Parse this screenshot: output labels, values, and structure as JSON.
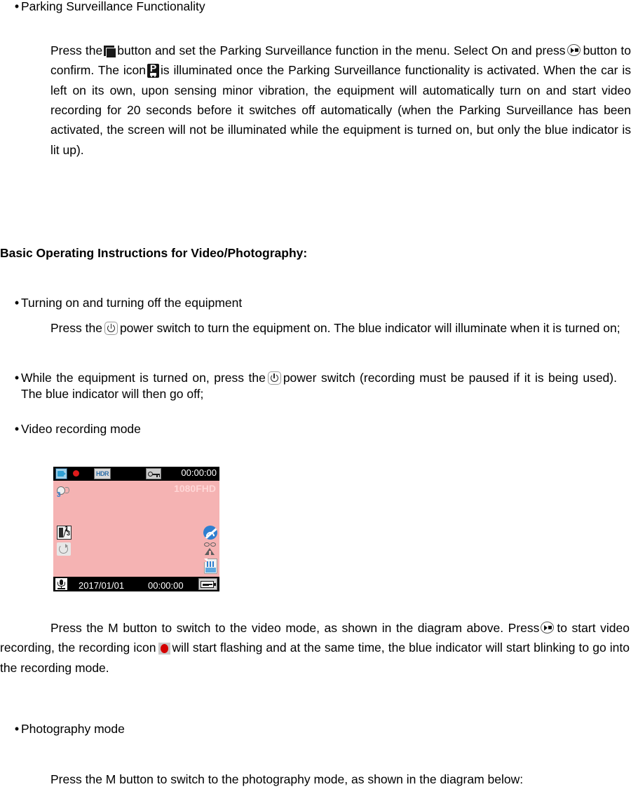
{
  "document": {
    "bullets": {
      "parking_surveillance": "Parking Surveillance Functionality",
      "turning_on_off": "Turning on and turning off the equipment",
      "while_turned_on": "While the equipment is turned on, press the",
      "video_recording_mode": "Video recording mode",
      "photography_mode": "Photography mode"
    },
    "heading_basic_operating": "Basic Operating Instructions for Video/Photography:",
    "parking_paragraph": {
      "part1": "Press the",
      "part2": "button and set the Parking Surveillance function in the menu. Select On and press",
      "part3": "button to confirm. The icon",
      "part4": "is illuminated once the Parking Surveillance functionality is activated. When the car is left on its own, upon sensing minor vibration, the equipment will automatically turn on and start video recording for 20 seconds before it switches off automatically (when the Parking Surveillance has been activated, the screen will not be illuminated while the equipment is turned on, but only the blue indicator is lit up)."
    },
    "turning_on_paragraph": {
      "part1": "Press the",
      "part2": "power switch to turn the equipment on. The blue indicator will illuminate when it is turned on;"
    },
    "turning_off_paragraph": {
      "part1": "power switch (recording must be paused if it is being used). The blue indicator will then go off;"
    },
    "video_mode_paragraph": {
      "part1": "Press the M button to switch to the video mode, as shown in the diagram above. Press",
      "part2": "to start video recording, the recording icon",
      "part3": "will start flashing and at the same time, the blue indicator will start blinking to go into the recording mode."
    },
    "photography_paragraph": "Press the M button to switch to the photography mode, as shown in the diagram below:"
  },
  "lcd_screen": {
    "top_timer": "00:00:00",
    "resolution": "1080FHD",
    "bottom_date": "2017/01/01",
    "bottom_time": "00:00:00",
    "hdr_label": "HDR",
    "exposure_value": "1",
    "exposure_fraction": "1/3",
    "audio_level": "3",
    "colors": {
      "screen_background": "#f5b3b3",
      "bar_background": "#000000",
      "resolution_text": "#ffd6d6",
      "record_dot": "#e01b1b",
      "accent_blue": "#2f7fd0"
    },
    "icons": [
      "camcorder-icon",
      "record-dot-icon",
      "hdr-icon",
      "key-lock-icon",
      "audio-level-icon",
      "exposure-icon",
      "loop-record-icon",
      "wifi-off-icon",
      "motion-detection-icon",
      "sd-card-icon",
      "microphone-icon",
      "battery-plug-icon"
    ]
  },
  "inline_icons": {
    "menu_button": "menu-button-icon",
    "ok_button": "ok-record-button-icon",
    "parking_badge": "parking-p-icon",
    "power_switch": "power-switch-icon",
    "record_dot": "red-record-dot-icon"
  }
}
